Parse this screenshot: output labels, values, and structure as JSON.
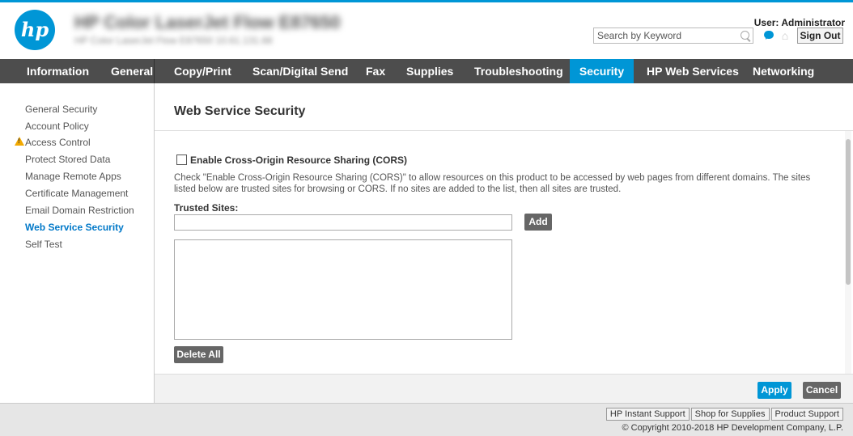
{
  "header": {
    "logo_text": "hp",
    "device_title": "HP Color LaserJet Flow E87650",
    "device_subtitle": "HP Color LaserJet Flow E87650    10.61.131.68",
    "search_placeholder": "Search by Keyword",
    "user_label": "User: Administrator",
    "signout_label": "Sign Out"
  },
  "nav": {
    "items": [
      "Information",
      "General",
      "Copy/Print",
      "Scan/Digital Send",
      "Fax",
      "Supplies",
      "Troubleshooting",
      "Security",
      "HP Web Services",
      "Networking"
    ],
    "active": "Security"
  },
  "sidebar": {
    "items": [
      "General Security",
      "Account Policy",
      "Access Control",
      "Protect Stored Data",
      "Manage Remote Apps",
      "Certificate Management",
      "Email Domain Restriction",
      "Web Service Security",
      "Self Test"
    ],
    "active": "Web Service Security",
    "warning_item": "Access Control"
  },
  "main": {
    "title": "Web Service Security",
    "cors_checkbox_label": "Enable Cross-Origin Resource Sharing (CORS)",
    "cors_checked": false,
    "description": "Check \"Enable Cross-Origin Resource Sharing (CORS)\" to allow resources on this product to be accessed by web pages from different domains. The sites listed below are trusted sites for browsing or CORS. If no sites are added to the list, then all sites are trusted.",
    "trusted_sites_label": "Trusted Sites:",
    "trusted_site_value": "",
    "add_label": "Add",
    "trusted_sites_list": [],
    "delete_all_label": "Delete All"
  },
  "actions": {
    "apply_label": "Apply",
    "cancel_label": "Cancel"
  },
  "footer": {
    "links": [
      "HP Instant Support",
      "Shop for Supplies",
      "Product Support"
    ],
    "copyright": "© Copyright 2010-2018 HP Development Company, L.P."
  },
  "colors": {
    "accent": "#0096d6",
    "nav_bg": "#4d4d4d",
    "button_gray": "#666666",
    "warning": "#f2a900"
  }
}
